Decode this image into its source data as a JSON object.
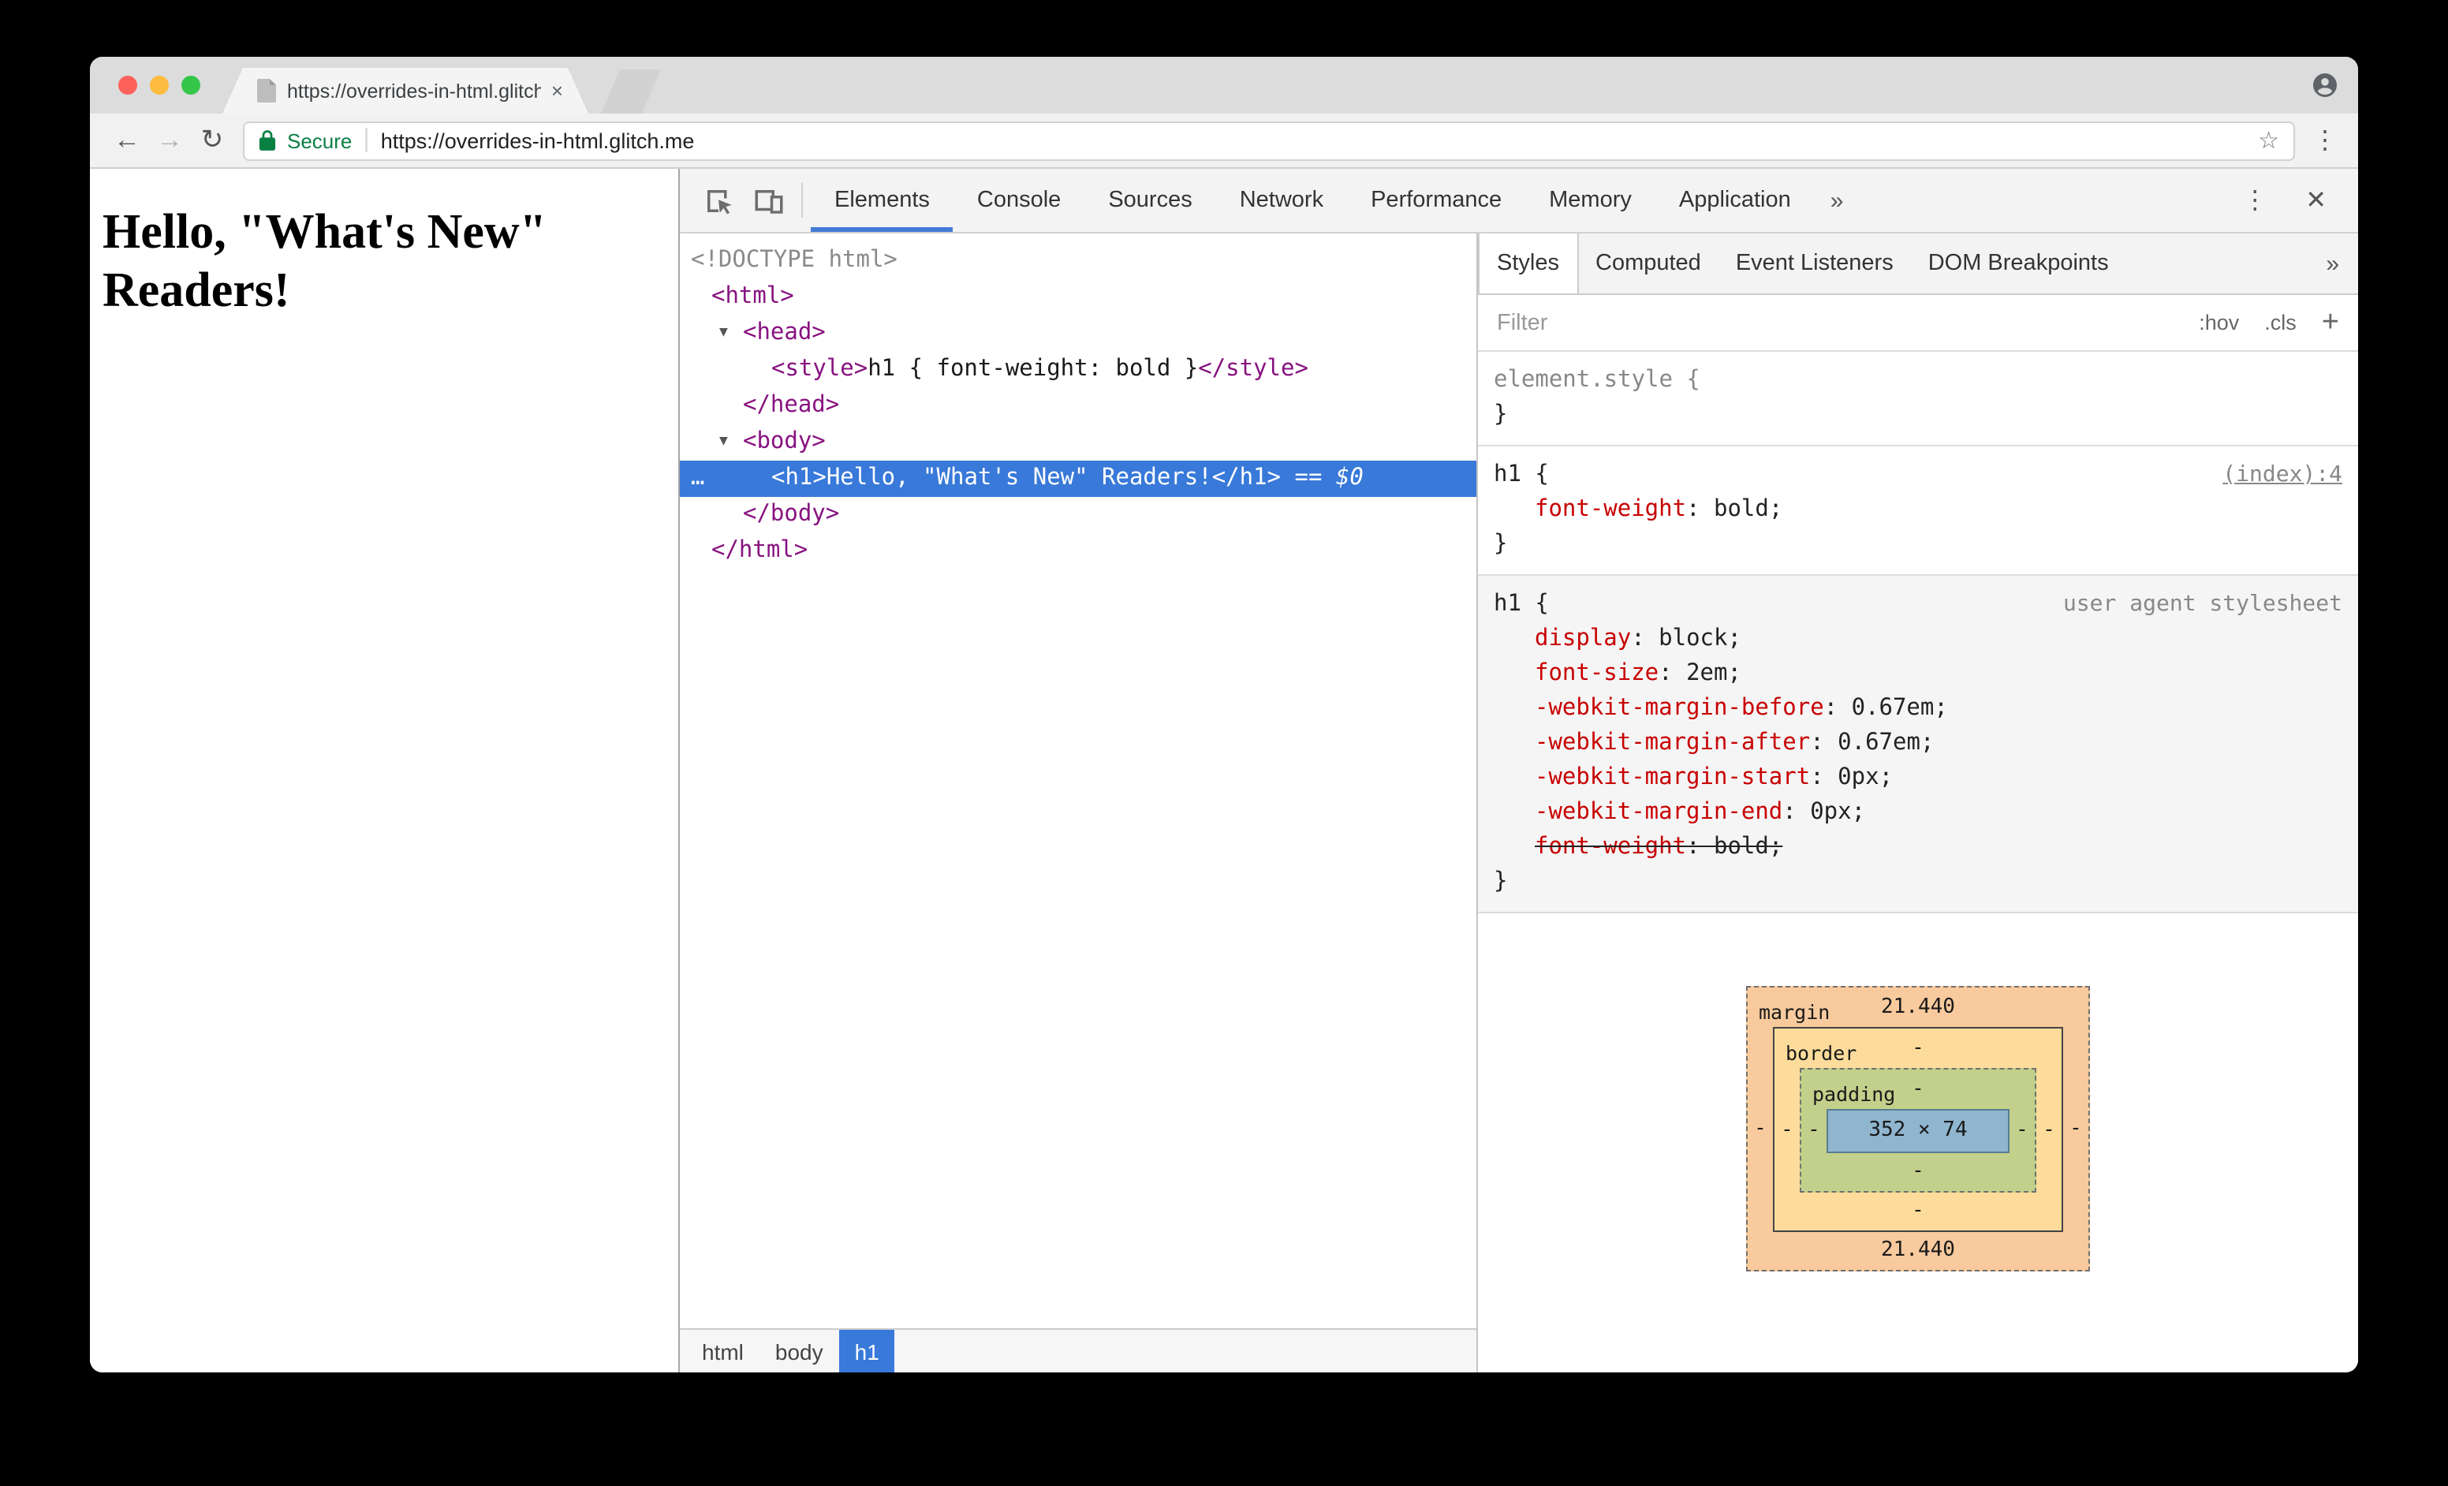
{
  "window": {
    "tab": {
      "title": "https://overrides-in-html.glitch",
      "close": "×"
    },
    "toolbar": {
      "back": "←",
      "forward": "→",
      "reload": "↻",
      "secure_label": "Secure",
      "url_divider": "|",
      "url": "https://overrides-in-html.glitch.me",
      "star": "☆",
      "menu": "⋮"
    }
  },
  "page": {
    "heading": "Hello, \"What's New\" Readers!"
  },
  "devtools": {
    "toolbar": {
      "tabs": [
        {
          "label": "Elements",
          "selected": true
        },
        {
          "label": "Console"
        },
        {
          "label": "Sources"
        },
        {
          "label": "Network"
        },
        {
          "label": "Performance"
        },
        {
          "label": "Memory"
        },
        {
          "label": "Application"
        }
      ],
      "more": "»",
      "menu": "⋮",
      "close": "✕"
    },
    "dom_tree": [
      {
        "indent": 0,
        "tokens": [
          {
            "t": "<!DOCTYPE html>",
            "c": "doctype"
          }
        ]
      },
      {
        "indent": 1,
        "tokens": [
          {
            "t": "<html>",
            "c": "tag"
          }
        ]
      },
      {
        "indent": 2,
        "arrow": true,
        "tokens": [
          {
            "t": "<head>",
            "c": "tag"
          }
        ]
      },
      {
        "indent": 3,
        "tokens": [
          {
            "t": "<style>",
            "c": "tag"
          },
          {
            "t": "h1 { font-weight: bold }",
            "c": "text"
          },
          {
            "t": "</style>",
            "c": "tag"
          }
        ]
      },
      {
        "indent": 2,
        "tokens": [
          {
            "t": "</head>",
            "c": "tag"
          }
        ]
      },
      {
        "indent": 2,
        "arrow": true,
        "tokens": [
          {
            "t": "<body>",
            "c": "tag"
          }
        ]
      },
      {
        "indent": 3,
        "selected": true,
        "prefix": "…",
        "tokens": [
          {
            "t": "<h1>",
            "c": "tag"
          },
          {
            "t": "Hello, \"What's New\" Readers!",
            "c": "text"
          },
          {
            "t": "</h1>",
            "c": "tag"
          },
          {
            "t": " == ",
            "c": "eq"
          },
          {
            "t": "$0",
            "c": "dollar"
          }
        ]
      },
      {
        "indent": 2,
        "tokens": [
          {
            "t": "</body>",
            "c": "tag"
          }
        ]
      },
      {
        "indent": 1,
        "tokens": [
          {
            "t": "</html>",
            "c": "tag"
          }
        ]
      }
    ],
    "breadcrumbs": [
      {
        "label": "html"
      },
      {
        "label": "body"
      },
      {
        "label": "h1",
        "selected": true
      }
    ],
    "sidebar": {
      "tabs": [
        {
          "label": "Styles",
          "selected": true
        },
        {
          "label": "Computed"
        },
        {
          "label": "Event Listeners"
        },
        {
          "label": "DOM Breakpoints"
        }
      ],
      "more": "»",
      "filter": {
        "placeholder": "Filter",
        "hov": ":hov",
        "cls": ".cls",
        "add": "+"
      },
      "syntax": {
        "open": "{",
        "close": "}",
        "colon": ": ",
        "semi": ";"
      },
      "rules": [
        {
          "selector": "element.style",
          "selector_class": "gray",
          "props": []
        },
        {
          "selector": "h1",
          "link": "(index):4",
          "link_underline": true,
          "props": [
            {
              "name": "font-weight",
              "value": "bold"
            }
          ]
        },
        {
          "selector": "h1",
          "link": "user agent stylesheet",
          "ua": true,
          "props": [
            {
              "name": "display",
              "value": "block"
            },
            {
              "name": "font-size",
              "value": "2em"
            },
            {
              "name": "-webkit-margin-before",
              "value": "0.67em"
            },
            {
              "name": "-webkit-margin-after",
              "value": "0.67em"
            },
            {
              "name": "-webkit-margin-start",
              "value": "0px"
            },
            {
              "name": "-webkit-margin-end",
              "value": "0px"
            },
            {
              "name": "font-weight",
              "value": "bold",
              "struck": true
            }
          ]
        }
      ],
      "box_model": {
        "margin": {
          "label": "margin",
          "top": "21.440",
          "bottom": "21.440",
          "left": "-",
          "right": "-"
        },
        "border": {
          "label": "border",
          "top": "-",
          "bottom": "-",
          "left": "-",
          "right": "-"
        },
        "padding": {
          "label": "padding",
          "top": "-",
          "bottom": "-",
          "left": "-",
          "right": "-"
        },
        "content": "352 × 74"
      }
    }
  },
  "colors": {
    "accent_blue": "#3879d9",
    "tag_purple": "#881280",
    "property_red": "#c80000",
    "secure_green": "#0b8043"
  }
}
